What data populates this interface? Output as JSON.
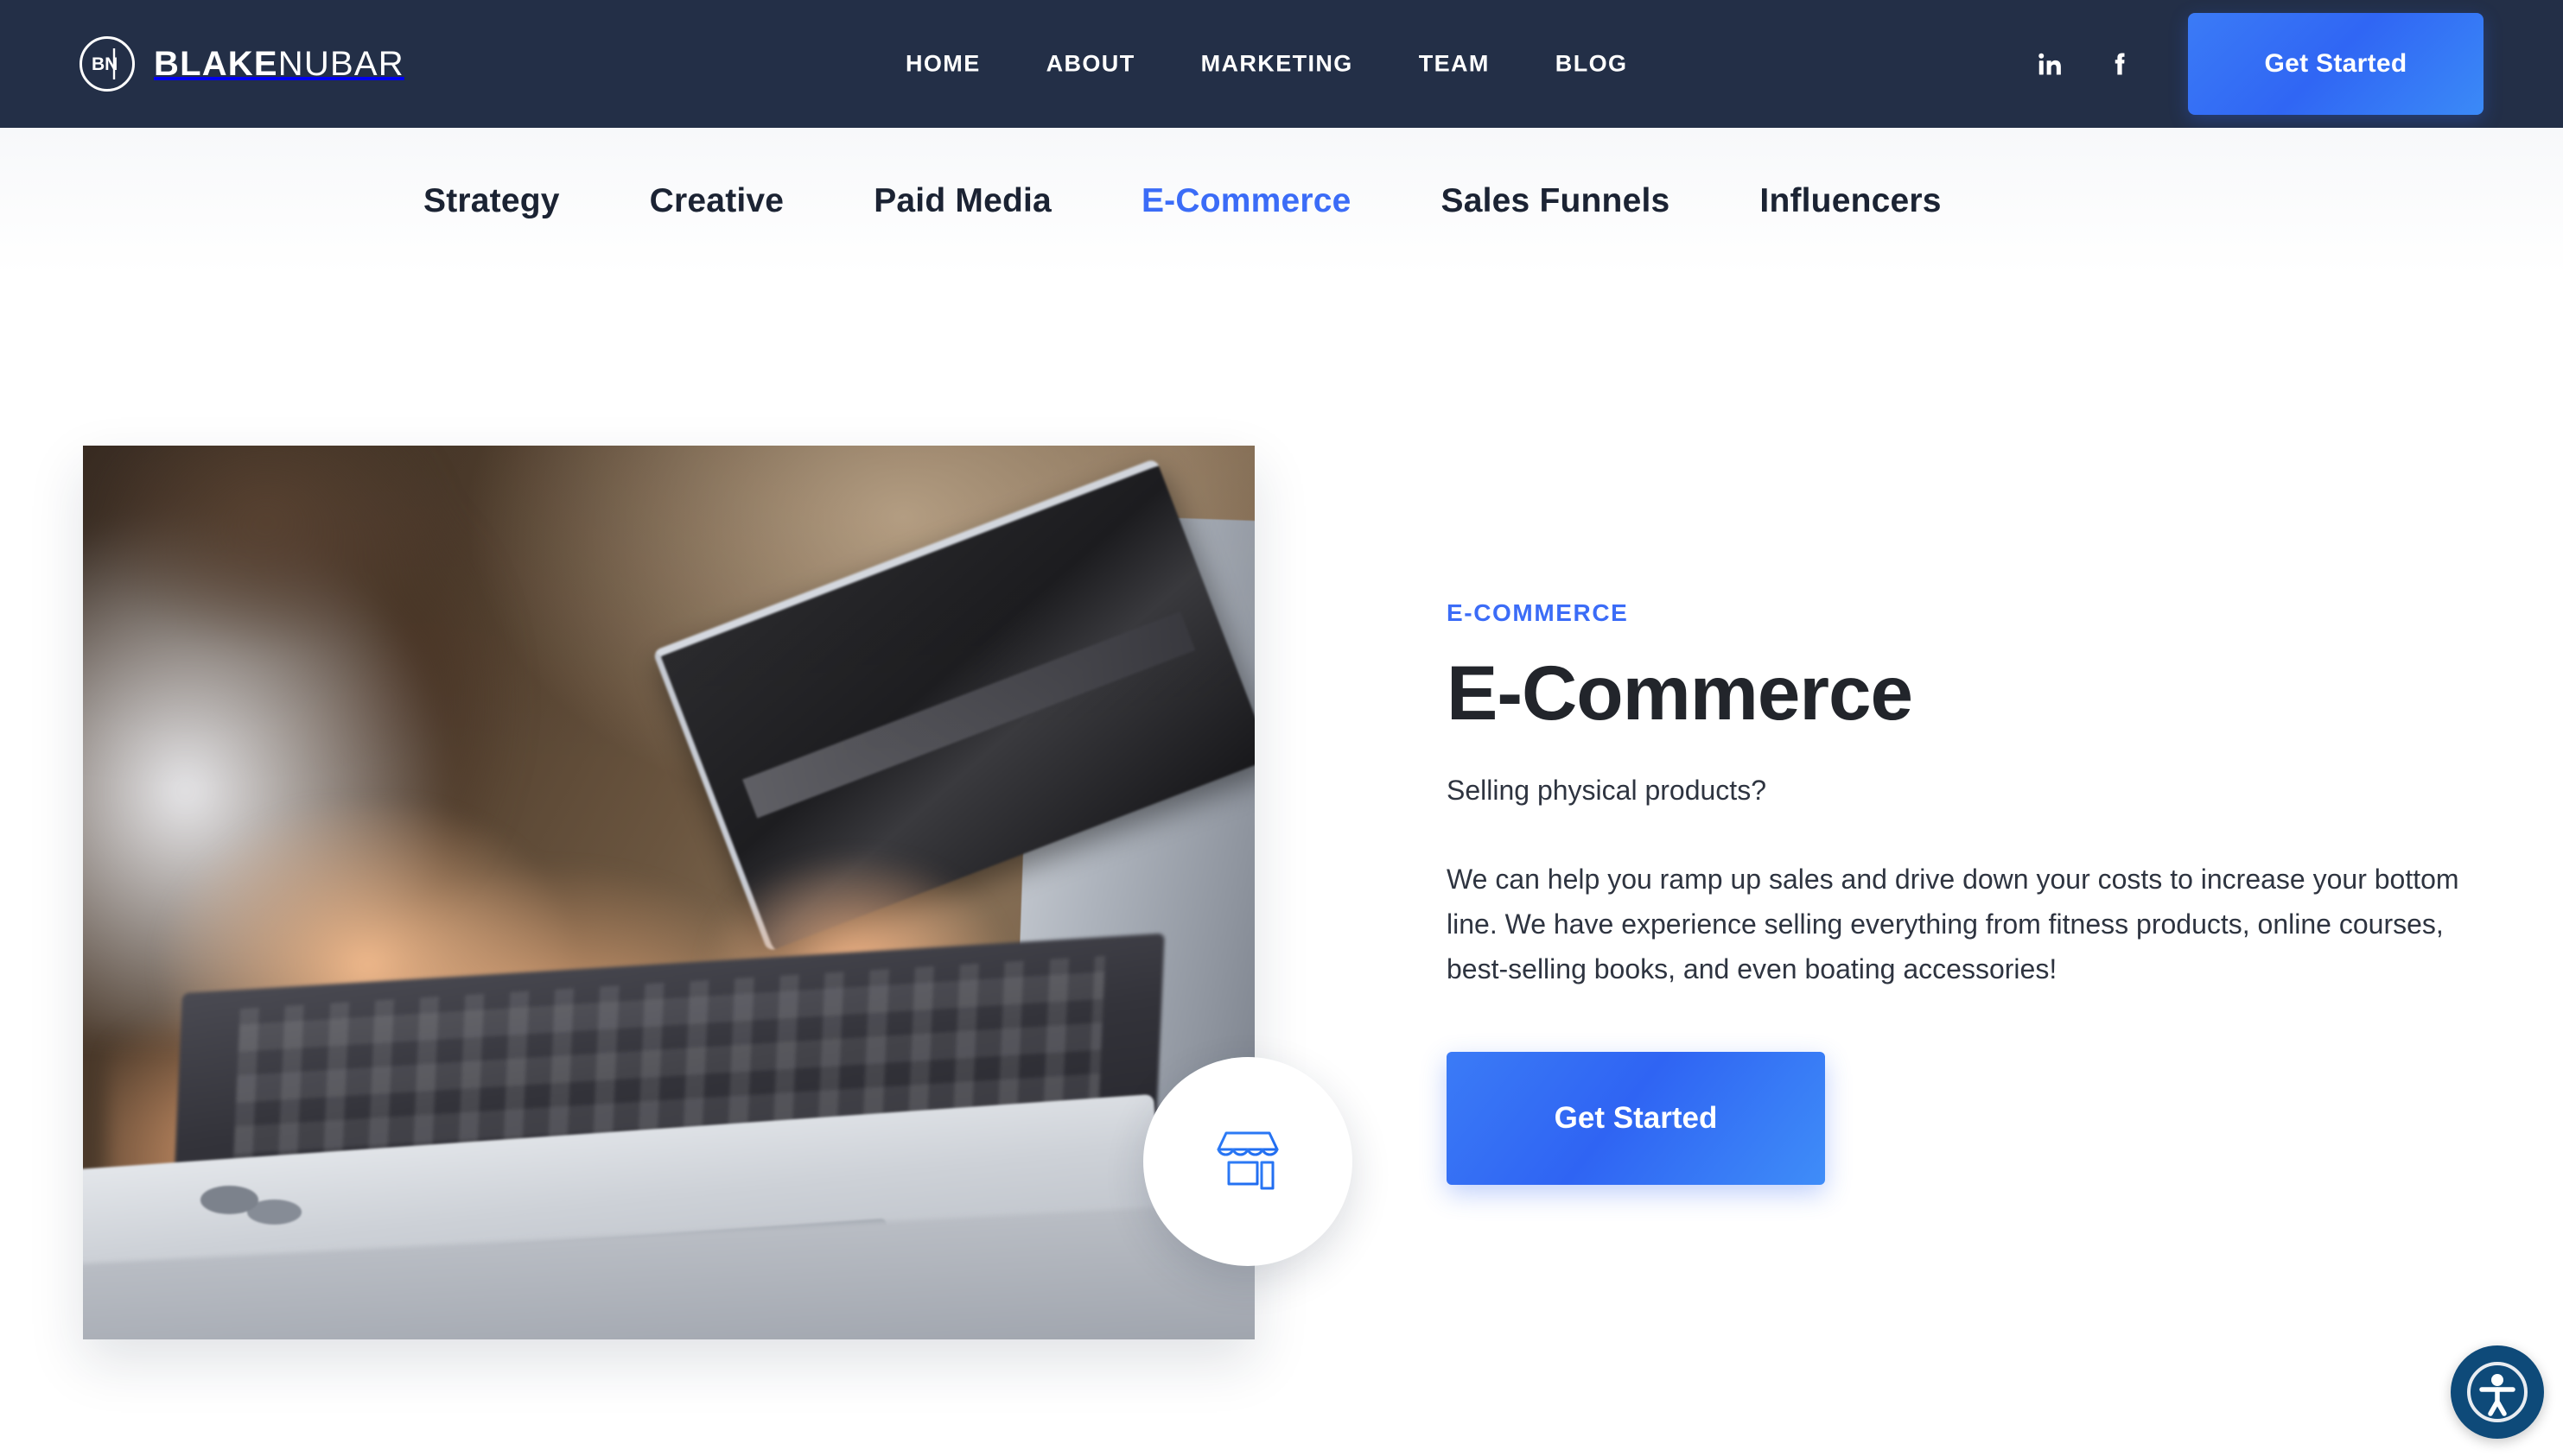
{
  "header": {
    "brand": {
      "mark": "bn-monogram-icon",
      "name_bold": "BLAKE",
      "name_light": "NUBAR"
    },
    "nav": [
      {
        "label": "HOME"
      },
      {
        "label": "ABOUT"
      },
      {
        "label": "MARKETING"
      },
      {
        "label": "TEAM"
      },
      {
        "label": "BLOG"
      }
    ],
    "social": [
      {
        "name": "linkedin-icon",
        "glyph": "in"
      },
      {
        "name": "facebook-icon",
        "glyph": "f"
      }
    ],
    "cta_label": "Get Started",
    "background_color": "#232f47"
  },
  "tabs": [
    {
      "label": "Strategy",
      "active": false
    },
    {
      "label": "Creative",
      "active": false
    },
    {
      "label": "Paid Media",
      "active": false
    },
    {
      "label": "E-Commerce",
      "active": true
    },
    {
      "label": "Sales Funnels",
      "active": false
    },
    {
      "label": "Influencers",
      "active": false
    }
  ],
  "media": {
    "alt": "Person holding a credit card while typing on a silver laptop",
    "badge_icon": "storefront-icon"
  },
  "content": {
    "eyebrow": "E-COMMERCE",
    "headline": "E-Commerce",
    "lede": "Selling physical products?",
    "paragraph": "We can help you ramp up sales and drive down your costs to increase your bottom line. We have experience selling everything from fitness products, online courses, best-selling books, and even boating accessories!",
    "cta_label": "Get Started"
  },
  "accessibility_widget": {
    "name": "accessibility-icon",
    "color": "#0e4a79"
  },
  "colors": {
    "accent_blue": "#3b6cf7",
    "header_navy": "#232f47",
    "heading_dark": "#22252b",
    "body_text": "#2e3440"
  }
}
